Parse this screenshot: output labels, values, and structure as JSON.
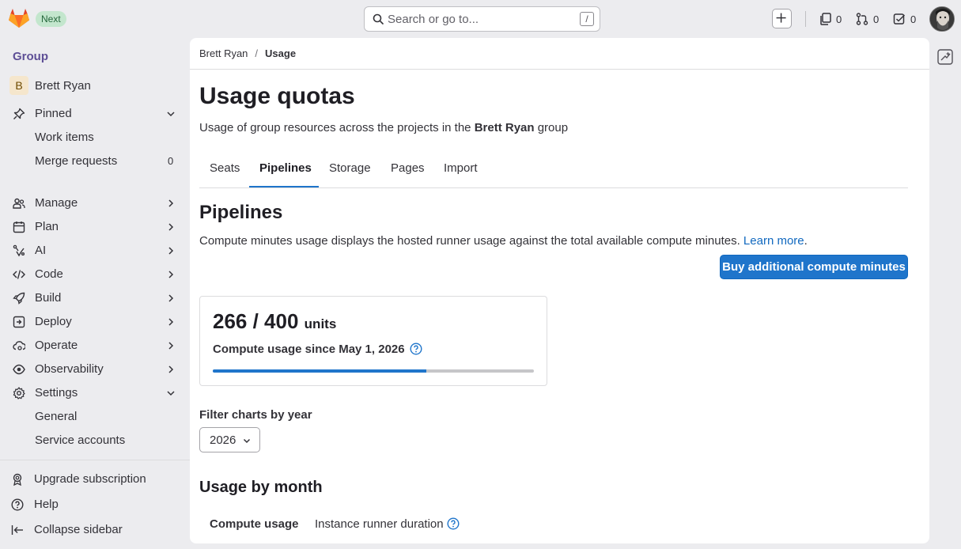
{
  "topbar": {
    "badge": "Next",
    "search_placeholder": "Search or go to...",
    "search_shortcut": "/",
    "issues_count": "0",
    "merge_requests_count": "0",
    "todos_count": "0"
  },
  "sidebar": {
    "context_label": "Group",
    "group_initial": "B",
    "group_name": "Brett Ryan",
    "pinned": {
      "label": "Pinned",
      "items": [
        {
          "label": "Work items",
          "count": ""
        },
        {
          "label": "Merge requests",
          "count": "0"
        }
      ]
    },
    "sections": [
      {
        "label": "Manage"
      },
      {
        "label": "Plan"
      },
      {
        "label": "AI"
      },
      {
        "label": "Code"
      },
      {
        "label": "Build"
      },
      {
        "label": "Deploy"
      },
      {
        "label": "Operate"
      },
      {
        "label": "Observability"
      },
      {
        "label": "Settings"
      }
    ],
    "settings_items": [
      {
        "label": "General"
      },
      {
        "label": "Service accounts"
      }
    ],
    "bottom": {
      "upgrade": "Upgrade subscription",
      "help": "Help",
      "collapse": "Collapse sidebar"
    }
  },
  "breadcrumb": {
    "parent": "Brett Ryan",
    "separator": "/",
    "current": "Usage"
  },
  "page": {
    "title": "Usage quotas",
    "desc_prefix": "Usage of group resources across the projects in the ",
    "desc_group": "Brett Ryan",
    "desc_suffix": " group"
  },
  "tabs": [
    {
      "label": "Seats"
    },
    {
      "label": "Pipelines"
    },
    {
      "label": "Storage"
    },
    {
      "label": "Pages"
    },
    {
      "label": "Import"
    }
  ],
  "active_tab": "Pipelines",
  "pipelines": {
    "title": "Pipelines",
    "description": "Compute minutes usage displays the hosted runner usage against the total available compute minutes. ",
    "learn_more": "Learn more",
    "learn_more_suffix": ".",
    "buy_button": "Buy additional compute minutes",
    "usage_value": "266 / 400",
    "usage_unit": "units",
    "used": 266,
    "quota": 400,
    "usage_label": "Compute usage since May 1, 2026",
    "filter_label": "Filter charts by year",
    "selected_year": "2026",
    "month_title": "Usage by month",
    "subtabs": [
      {
        "label": "Compute usage"
      },
      {
        "label": "Instance runner duration"
      }
    ]
  },
  "colors": {
    "accent": "#1f75cb",
    "group_label": "#5e4f96",
    "badge_bg": "#c3e6cd"
  }
}
